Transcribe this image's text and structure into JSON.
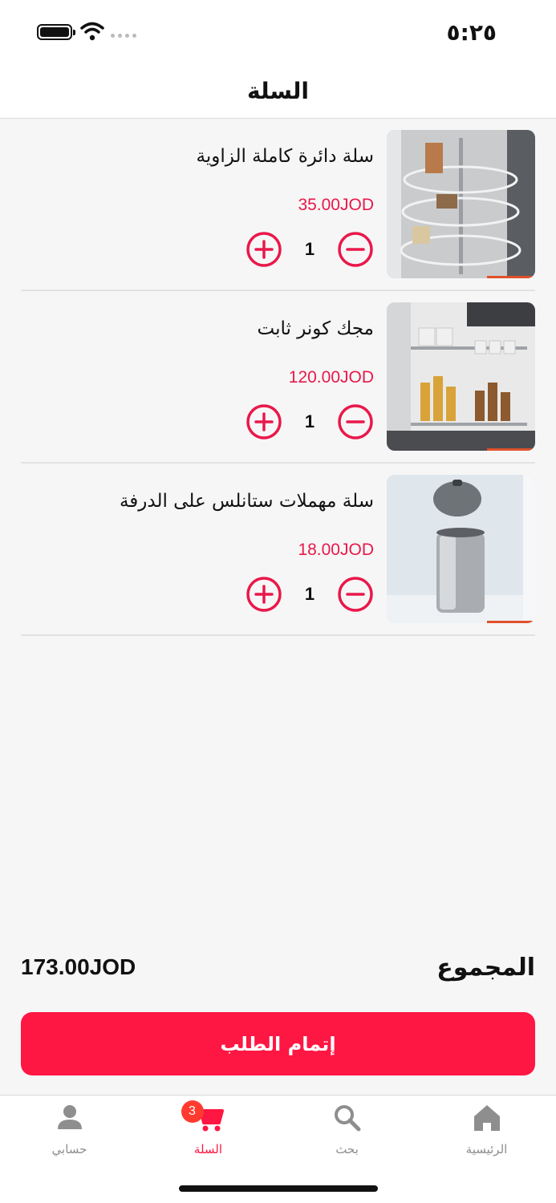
{
  "status_bar": {
    "time": "٥:٢٥"
  },
  "header": {
    "title": "السلة"
  },
  "cart": {
    "items": [
      {
        "title": "سلة دائرة كاملة الزاوية",
        "price": "35.00JOD",
        "quantity": "1",
        "image": "corner-carousel-basket"
      },
      {
        "title": "مجك كونر ثابت",
        "price": "120.00JOD",
        "quantity": "1",
        "image": "corner-pullout-rack"
      },
      {
        "title": "سلة مهملات ستانلس على الدرفة",
        "price": "18.00JOD",
        "quantity": "1",
        "image": "stainless-trash-bin"
      }
    ],
    "plus_icon": "plus-circle-icon",
    "minus_icon": "minus-circle-icon"
  },
  "summary": {
    "total_label": "المجموع",
    "total_value": "173.00JOD"
  },
  "checkout": {
    "label": "إتمام الطلب"
  },
  "tabbar": {
    "tabs": [
      {
        "label": "حسابي",
        "icon": "person-icon"
      },
      {
        "label": "السلة",
        "icon": "cart-icon",
        "badge": "3",
        "active": true
      },
      {
        "label": "بحث",
        "icon": "search-icon"
      },
      {
        "label": "الرئيسية",
        "icon": "home-icon"
      }
    ]
  },
  "colors": {
    "accent": "#ff1744",
    "price": "#e9184a",
    "background": "#f6f6f6"
  }
}
